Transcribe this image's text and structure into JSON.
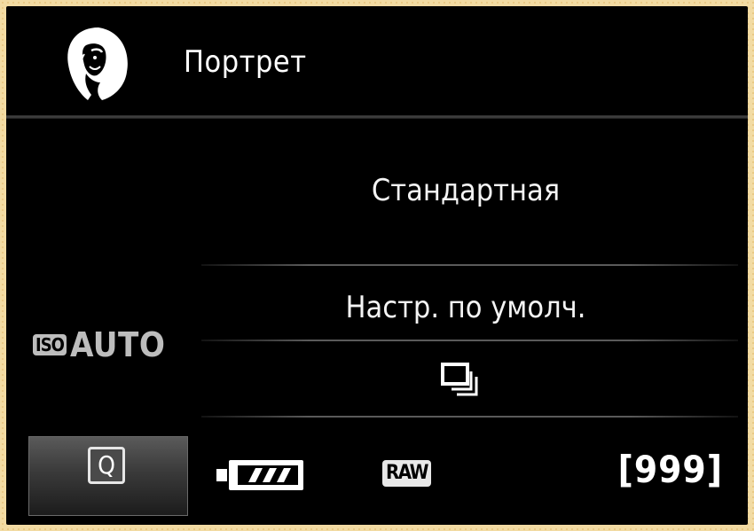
{
  "mode": {
    "title": "Портрет",
    "icon": "portrait-icon"
  },
  "settings": {
    "picture_style": "Стандартная",
    "defaults": "Настр. по умолч.",
    "drive_mode_icon": "continuous-shooting-icon"
  },
  "iso": {
    "badge": "ISO",
    "value": "AUTO"
  },
  "status": {
    "quick_control_label": "Q",
    "battery_icon": "battery-full-icon",
    "quality": "RAW",
    "shots_remaining": "[999]"
  }
}
